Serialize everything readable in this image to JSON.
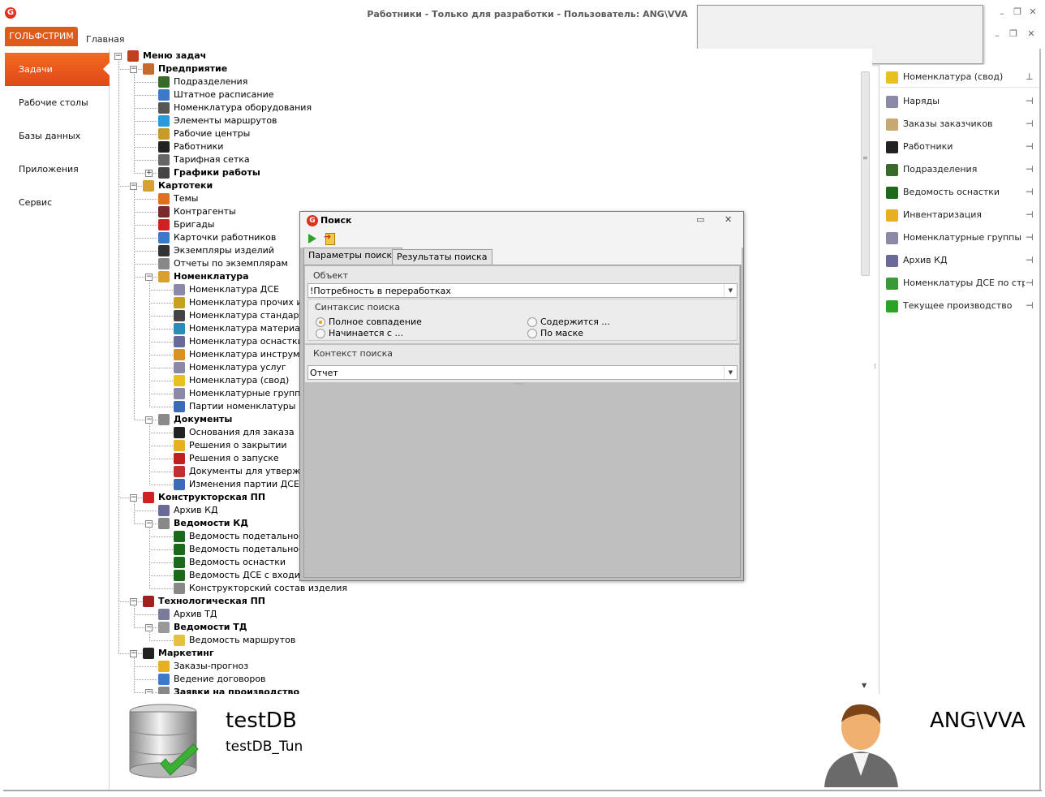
{
  "window": {
    "title": "Работники - Только для разработки  - Пользователь: ANG\\VVA",
    "logo": "G"
  },
  "ribbon": {
    "tabs": [
      "ГОЛЬФСТРИМ",
      "Главная"
    ]
  },
  "nav": {
    "items": [
      "Задачи",
      "Рабочие столы",
      "Базы данных",
      "Приложения",
      "Сервис"
    ],
    "active": "Задачи"
  },
  "tree": {
    "rows": [
      {
        "label": "Меню задач",
        "level": 0,
        "bold": true,
        "expander": "−",
        "icon": "task-menu-icon",
        "color": "#c04020"
      },
      {
        "label": "Предприятие",
        "level": 1,
        "bold": true,
        "expander": "−",
        "icon": "enterprise-icon",
        "color": "#c86a2a"
      },
      {
        "label": "Подразделения",
        "level": 2,
        "icon": "departments-icon",
        "color": "#3a6a2a"
      },
      {
        "label": "Штатное расписание",
        "level": 2,
        "icon": "staff-schedule-icon",
        "color": "#3a7ac8"
      },
      {
        "label": "Номенклатура оборудования",
        "level": 2,
        "icon": "equipment-icon",
        "color": "#555555"
      },
      {
        "label": "Элементы маршрутов",
        "level": 2,
        "icon": "route-elements-icon",
        "color": "#2a9ad8"
      },
      {
        "label": "Рабочие центры",
        "level": 2,
        "icon": "work-centers-icon",
        "color": "#c89a2a"
      },
      {
        "label": "Работники",
        "level": 2,
        "icon": "workers-icon",
        "color": "#222222"
      },
      {
        "label": "Тарифная сетка",
        "level": 2,
        "icon": "tariff-grid-icon",
        "color": "#666666"
      },
      {
        "label": "Графики работы",
        "level": 2,
        "bold": true,
        "expander": "+",
        "icon": "work-schedules-icon",
        "color": "#444444"
      },
      {
        "label": "Картотеки",
        "level": 1,
        "bold": true,
        "expander": "−",
        "icon": "card-files-icon",
        "color": "#d8a030"
      },
      {
        "label": "Темы",
        "level": 2,
        "icon": "themes-icon",
        "color": "#e07020"
      },
      {
        "label": "Контрагенты",
        "level": 2,
        "icon": "contractors-icon",
        "color": "#7a2a2a"
      },
      {
        "label": "Бригады",
        "level": 2,
        "icon": "brigades-icon",
        "color": "#d02020"
      },
      {
        "label": "Карточки работников",
        "level": 2,
        "icon": "worker-cards-icon",
        "color": "#3a7ac8"
      },
      {
        "label": "Экземпляры изделий",
        "level": 2,
        "icon": "product-instances-icon",
        "color": "#333333"
      },
      {
        "label": "Отчеты по экземплярам",
        "level": 2,
        "icon": "instance-reports-icon",
        "color": "#888888"
      },
      {
        "label": "Номенклатура",
        "level": 2,
        "bold": true,
        "expander": "−",
        "icon": "nomenclature-icon",
        "color": "#d8a030"
      },
      {
        "label": "Номенклатура ДСЕ",
        "level": 3,
        "icon": "nomenclature-dse-icon",
        "color": "#8a8aa8"
      },
      {
        "label": "Номенклатура прочих изделий",
        "level": 3,
        "icon": "other-products-icon",
        "color": "#c8a020"
      },
      {
        "label": "Номенклатура стандартных изделий",
        "level": 3,
        "icon": "standard-products-icon",
        "color": "#444444"
      },
      {
        "label": "Номенклатура материалов",
        "level": 3,
        "icon": "materials-icon",
        "color": "#2a8ab8"
      },
      {
        "label": "Номенклатура оснастки",
        "level": 3,
        "icon": "tooling-icon",
        "color": "#6a6a9a"
      },
      {
        "label": "Номенклатура инструмента",
        "level": 3,
        "icon": "instruments-icon",
        "color": "#d89020"
      },
      {
        "label": "Номенклатура услуг",
        "level": 3,
        "icon": "services-icon",
        "color": "#8a8aa8"
      },
      {
        "label": "Номенклатура (свод)",
        "level": 3,
        "icon": "nomenclature-summary-icon",
        "color": "#e8c020"
      },
      {
        "label": "Номенклатурные группы",
        "level": 3,
        "icon": "nomenclature-groups-icon",
        "color": "#8a8aa8"
      },
      {
        "label": "Партии номенклатуры",
        "level": 3,
        "icon": "nomenclature-batches-icon",
        "color": "#3a6ab8"
      },
      {
        "label": "Документы",
        "level": 2,
        "bold": true,
        "expander": "−",
        "icon": "documents-icon",
        "color": "#8a8a8a"
      },
      {
        "label": "Основания для заказа",
        "level": 3,
        "icon": "order-grounds-icon",
        "color": "#222222"
      },
      {
        "label": "Решения о закрытии",
        "level": 3,
        "icon": "closure-decisions-icon",
        "color": "#e8b020"
      },
      {
        "label": "Решения о запуске",
        "level": 3,
        "icon": "launch-decisions-icon",
        "color": "#c02020"
      },
      {
        "label": "Документы для утверждения",
        "level": 3,
        "icon": "approval-documents-icon",
        "color": "#c03030"
      },
      {
        "label": "Изменения партии ДСЕ",
        "level": 3,
        "icon": "dse-batch-changes-icon",
        "color": "#3a6ab8"
      },
      {
        "label": "Конструкторская ПП",
        "level": 1,
        "bold": true,
        "expander": "−",
        "icon": "design-pp-icon",
        "color": "#d02020"
      },
      {
        "label": "Архив КД",
        "level": 2,
        "icon": "kd-archive-icon",
        "color": "#6a6a9a"
      },
      {
        "label": "Ведомости КД",
        "level": 2,
        "bold": true,
        "expander": "−",
        "icon": "kd-statements-icon",
        "color": "#888888"
      },
      {
        "label": "Ведомость подетально-специфицированная",
        "level": 3,
        "icon": "statement-icon",
        "color": "#1a6a1a"
      },
      {
        "label": "Ведомость подетально-специфицированная",
        "level": 3,
        "icon": "statement-icon",
        "color": "#1a6a1a"
      },
      {
        "label": "Ведомость оснастки",
        "level": 3,
        "icon": "statement-icon",
        "color": "#1a6a1a"
      },
      {
        "label": "Ведомость ДСЕ с входимостью",
        "level": 3,
        "icon": "statement-icon",
        "color": "#1a6a1a"
      },
      {
        "label": "Конструкторский состав изделия",
        "level": 3,
        "icon": "design-composition-icon",
        "color": "#888888"
      },
      {
        "label": "Технологическая ПП",
        "level": 1,
        "bold": true,
        "expander": "−",
        "icon": "tech-pp-icon",
        "color": "#a02020"
      },
      {
        "label": "Архив ТД",
        "level": 2,
        "icon": "td-archive-icon",
        "color": "#7a7a9a"
      },
      {
        "label": "Ведомости ТД",
        "level": 2,
        "bold": true,
        "expander": "−",
        "icon": "td-statements-icon",
        "color": "#999999"
      },
      {
        "label": "Ведомость маршрутов",
        "level": 3,
        "icon": "routes-statement-icon",
        "color": "#e8c040"
      },
      {
        "label": "Маркетинг",
        "level": 1,
        "bold": true,
        "expander": "−",
        "icon": "marketing-icon",
        "color": "#222222"
      },
      {
        "label": "Заказы-прогноз",
        "level": 2,
        "icon": "forecast-orders-icon",
        "color": "#e8b020"
      },
      {
        "label": "Ведение договоров",
        "level": 2,
        "icon": "contracts-icon",
        "color": "#3a7ac8"
      },
      {
        "label": "Заявки на производство",
        "level": 2,
        "bold": true,
        "expander": "−",
        "icon": "production-requests-icon",
        "color": "#888888"
      }
    ]
  },
  "favorites": {
    "items": [
      {
        "label": "Номенклатура (свод)",
        "icon": "nomenclature-summary-icon",
        "color": "#e8c020"
      },
      {
        "label": "Наряды",
        "icon": "work-orders-icon",
        "color": "#8a8aa8"
      },
      {
        "label": "Заказы заказчиков",
        "icon": "customer-orders-icon",
        "color": "#c8a870"
      },
      {
        "label": "Работники",
        "icon": "workers-icon",
        "color": "#222222"
      },
      {
        "label": "Подразделения",
        "icon": "departments-icon",
        "color": "#3a6a2a"
      },
      {
        "label": "Ведомость оснастки",
        "icon": "statement-icon",
        "color": "#1a6a1a"
      },
      {
        "label": "Инвентаризация",
        "icon": "inventory-icon",
        "color": "#e8b020"
      },
      {
        "label": "Номенклатурные группы",
        "icon": "nomenclature-groups-icon",
        "color": "#8a8aa8"
      },
      {
        "label": "Архив КД",
        "icon": "kd-archive-icon",
        "color": "#6a6a9a"
      },
      {
        "label": "Номенклатуры ДСЕ по страховому запасу",
        "icon": "dse-stock-icon",
        "color": "#3a9a3a"
      },
      {
        "label": "Текущее производство",
        "icon": "current-production-icon",
        "color": "#2aa326"
      }
    ]
  },
  "footer": {
    "db_name": "testDB",
    "db_sub": "testDB_Tun",
    "user": "ANG\\VVA"
  },
  "dialog": {
    "title": "Поиск",
    "tabs": [
      "Параметры поиска",
      "Результаты поиска"
    ],
    "object_caption": "Объект",
    "object_value": "!Потребность в переработках",
    "syntax_caption": "Синтаксис поиска",
    "options": {
      "exact": "Полное совпадение",
      "starts": "Начинается с ...",
      "contains": "Содержится ...",
      "mask": "По маске"
    },
    "selected": "Полное совпадение",
    "context_caption": "Контекст поиска",
    "context_value": "Отчет"
  },
  "colors": {
    "accent": "#e05a1c",
    "dialog_bg": "#bfbfbf"
  }
}
